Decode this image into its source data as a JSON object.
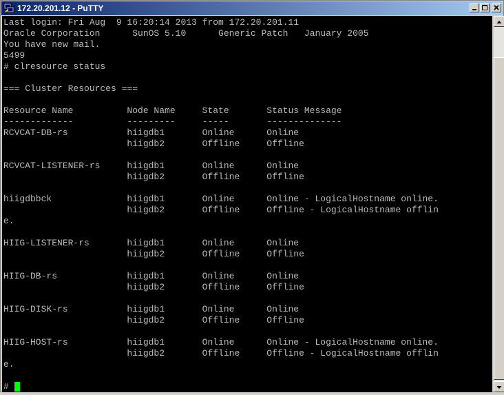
{
  "window": {
    "title": "172.20.201.12 - PuTTY",
    "icons": {
      "app": "putty-icon",
      "minimize": "minimize-icon",
      "maximize": "maximize-icon",
      "close": "close-icon"
    }
  },
  "terminal": {
    "colors": {
      "background": "#000000",
      "text": "#bbbbbb",
      "cursor": "#00ff00"
    },
    "lines": [
      "Last login: Fri Aug  9 16:20:14 2013 from 172.20.201.11",
      "Oracle Corporation      SunOS 5.10      Generic Patch   January 2005",
      "You have new mail.",
      "5499",
      "# clresource status",
      "",
      "=== Cluster Resources ===",
      "",
      "Resource Name          Node Name     State       Status Message",
      "-------------          ---------     -----       --------------",
      "RCVCAT-DB-rs           hiigdb1       Online      Online",
      "                       hiigdb2       Offline     Offline",
      "",
      "RCVCAT-LISTENER-rs     hiigdb1       Online      Online",
      "                       hiigdb2       Offline     Offline",
      "",
      "hiigdbbck              hiigdb1       Online      Online - LogicalHostname online.",
      "                       hiigdb2       Offline     Offline - LogicalHostname offlin",
      "e.",
      "",
      "HIIG-LISTENER-rs       hiigdb1       Online      Online",
      "                       hiigdb2       Offline     Offline",
      "",
      "HIIG-DB-rs             hiigdb1       Online      Online",
      "                       hiigdb2       Offline     Offline",
      "",
      "HIIG-DISK-rs           hiigdb1       Online      Online",
      "                       hiigdb2       Offline     Offline",
      "",
      "HIIG-HOST-rs           hiigdb1       Online      Online - LogicalHostname online.",
      "                       hiigdb2       Offline     Offline - LogicalHostname offlin",
      "e.",
      ""
    ],
    "prompt": "# "
  }
}
